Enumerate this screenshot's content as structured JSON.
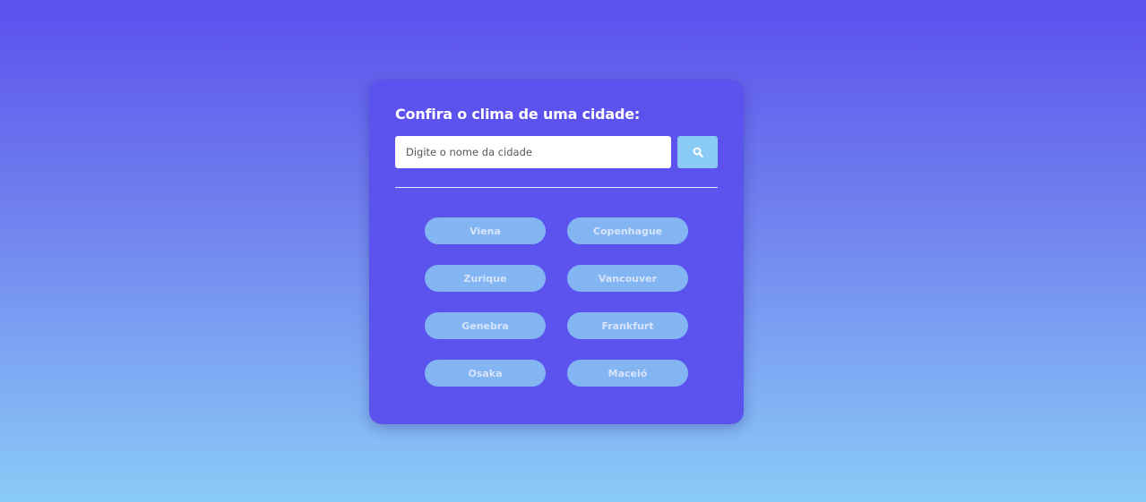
{
  "card": {
    "title": "Confira o clima de uma cidade:"
  },
  "search": {
    "placeholder": "Digite o nome da cidade",
    "value": "",
    "button_icon": "search-icon"
  },
  "cities": [
    {
      "label": "Viena"
    },
    {
      "label": "Copenhague"
    },
    {
      "label": "Zurique"
    },
    {
      "label": "Vancouver"
    },
    {
      "label": "Genebra"
    },
    {
      "label": "Frankfurt"
    },
    {
      "label": "Osaka"
    },
    {
      "label": "Maceió"
    }
  ],
  "colors": {
    "card_background": "#5c53ee",
    "search_button": "#8acbf6",
    "city_button": "#83b5f3",
    "city_text": "#d6e4fb",
    "gradient_top": "#5b50ee",
    "gradient_bottom": "#8acbf7"
  }
}
